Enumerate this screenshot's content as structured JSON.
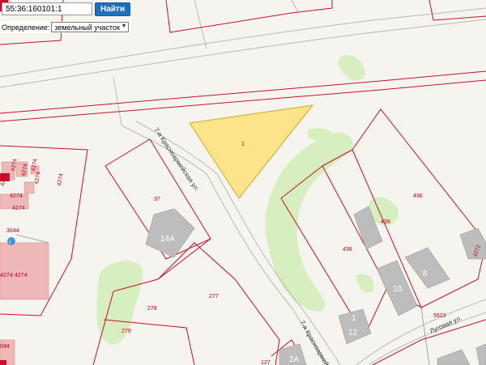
{
  "search": {
    "value": "55:36:160101:1",
    "button_label": "Найти"
  },
  "definition": {
    "label": "Определение:",
    "selected": "земельный участок"
  },
  "map": {
    "plot_numbers": [
      "1",
      "37",
      "277",
      "278",
      "279",
      "436",
      "438",
      "439",
      "5623",
      "3044",
      "4274",
      "4274",
      "4274",
      "4274",
      "4274",
      "4274",
      "4274",
      "4274",
      "4274",
      "4274",
      "127",
      "4272",
      "044",
      "4"
    ],
    "building_numbers": [
      "14А",
      "1",
      "12",
      "10",
      "8",
      "2А"
    ],
    "streets": [
      "7-я Красноармейская ул.",
      "7-я Красноармейская",
      "Луговая ул."
    ],
    "colors": {
      "selected_fill": "#fde38a",
      "selected_stroke": "#d4a826",
      "boundary": "#c8102e",
      "green": "#d6eec0",
      "building": "#bdbdbd"
    }
  }
}
